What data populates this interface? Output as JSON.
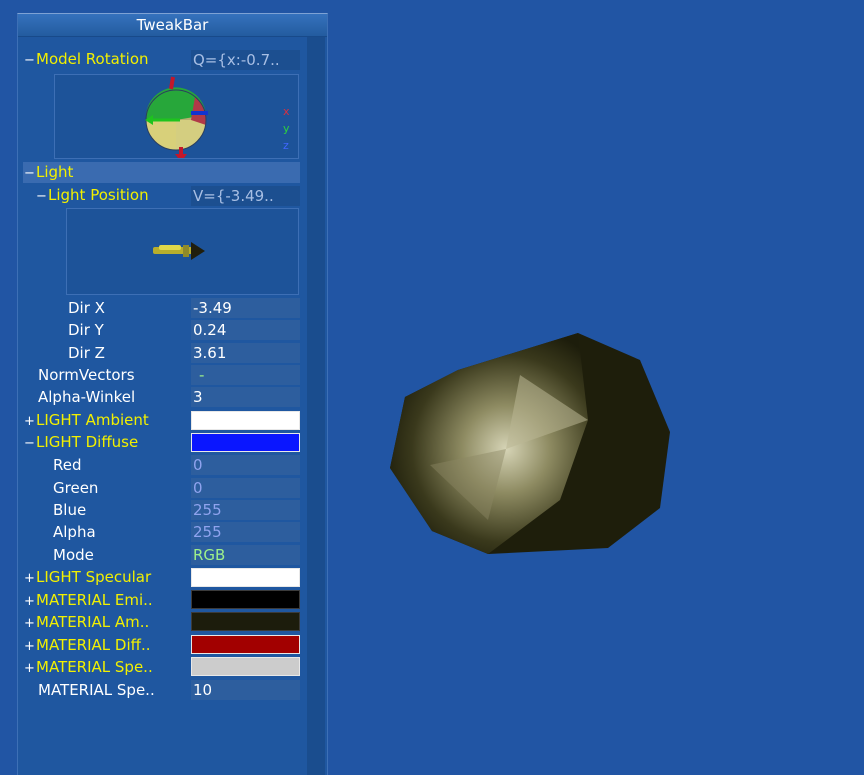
{
  "tweakbar": {
    "title": "TweakBar",
    "rows": {
      "model_rotation": {
        "toggle": "−",
        "label": "Model Rotation",
        "value": "Q={x:-0.7.."
      },
      "light": {
        "toggle": "−",
        "label": "Light"
      },
      "light_position": {
        "toggle": "−",
        "label": "Light Position",
        "value": "V={-3.49.."
      },
      "dir_x": {
        "label": "Dir X",
        "value": "-3.49"
      },
      "dir_y": {
        "label": "Dir Y",
        "value": "0.24"
      },
      "dir_z": {
        "label": "Dir Z",
        "value": "3.61"
      },
      "norm_vectors": {
        "label": "NormVectors",
        "value": "-"
      },
      "alpha_winkel": {
        "label": "Alpha-Winkel",
        "value": "3"
      },
      "light_ambient": {
        "toggle": "+",
        "label": "LIGHT Ambient",
        "color": "#ffffff"
      },
      "light_diffuse": {
        "toggle": "−",
        "label": "LIGHT Diffuse",
        "color": "#0a16ff"
      },
      "red": {
        "label": "Red",
        "value": "0"
      },
      "green": {
        "label": "Green",
        "value": "0"
      },
      "blue": {
        "label": "Blue",
        "value": "255"
      },
      "alpha": {
        "label": "Alpha",
        "value": "255"
      },
      "mode": {
        "label": "Mode",
        "value": "RGB"
      },
      "light_specular": {
        "toggle": "+",
        "label": "LIGHT Specular",
        "color": "#ffffff"
      },
      "material_emission": {
        "toggle": "+",
        "label": "MATERIAL Emi..",
        "color": "#000000"
      },
      "material_ambient": {
        "toggle": "+",
        "label": "MATERIAL Am..",
        "color": "#1c1c0c"
      },
      "material_diffuse": {
        "toggle": "+",
        "label": "MATERIAL Diff..",
        "color": "#a20000"
      },
      "material_specular": {
        "toggle": "+",
        "label": "MATERIAL Spe..",
        "color": "#cccccc"
      },
      "material_shininess": {
        "label": "MATERIAL Spe..",
        "value": "10"
      }
    },
    "axis_labels": {
      "x": "x",
      "y": "y",
      "z": "z"
    }
  },
  "colors": {
    "background": "#2155a4",
    "group_label": "#f2f000",
    "rock_dark": "#1c1c0a",
    "rock_highlight": "#d2d0b4"
  }
}
